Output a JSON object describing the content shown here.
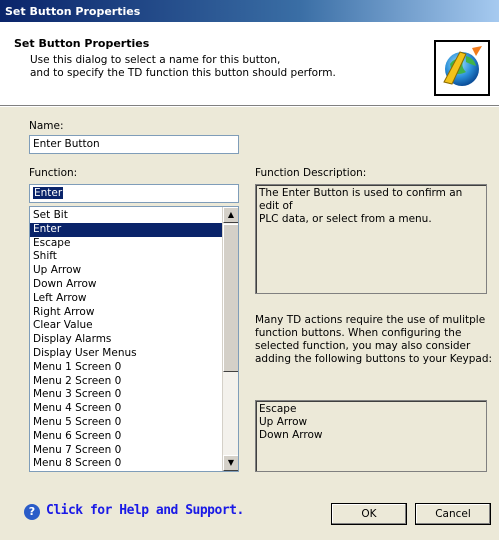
{
  "window": {
    "title": "Set Button Properties"
  },
  "header": {
    "title": "Set Button Properties",
    "description_lines": [
      "Use this dialog to select a name for this button,",
      "and to specify the TD function this button should perform."
    ],
    "logo_icon": "wizard-logo-icon"
  },
  "name_section": {
    "label": "Name:",
    "value": "Enter Button"
  },
  "function_section": {
    "label": "Function:",
    "value": "Enter",
    "items": [
      "Set Bit",
      "Enter",
      "Escape",
      "Shift",
      "Up Arrow",
      "Down Arrow",
      "Left Arrow",
      "Right Arrow",
      "Clear Value",
      "Display Alarms",
      "Display User Menus",
      "Menu 1 Screen 0",
      "Menu 2 Screen 0",
      "Menu 3 Screen 0",
      "Menu 4 Screen 0",
      "Menu 5 Screen 0",
      "Menu 6 Screen 0",
      "Menu 7 Screen 0",
      "Menu 8 Screen 0"
    ],
    "selected_index": 1
  },
  "description_section": {
    "label": "Function Description:",
    "text_lines": [
      "The Enter Button is used to confirm an edit of",
      "PLC data, or select from a menu."
    ]
  },
  "note": {
    "lines": [
      "Many TD actions require the use of mulitple",
      "function buttons.  When configuring the",
      "selected function, you may also consider",
      "adding the following buttons to your Keypad:"
    ]
  },
  "suggested_buttons": [
    "Escape",
    "Up Arrow",
    "Down Arrow"
  ],
  "footer": {
    "help_text": "Click for Help and Support.",
    "ok_label": "OK",
    "cancel_label": "Cancel"
  },
  "colors": {
    "selection": "#0a246a",
    "help_link": "#1a1ae6",
    "dialog_bg": "#ece9d8"
  }
}
